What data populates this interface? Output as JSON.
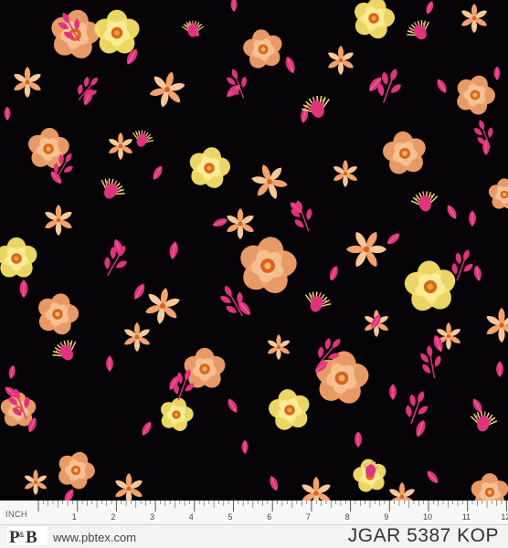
{
  "fabric": {
    "background_color": "#050305",
    "palette": {
      "peach": "#f3a26c",
      "peach_light": "#f8c79a",
      "orange_center": "#d8651f",
      "yellow": "#f6e16a",
      "yellow_light": "#fbef9c",
      "pink": "#e0337e",
      "pink_light": "#f07aa6"
    },
    "motifs": [
      "peach-rose-icon",
      "yellow-rose-icon",
      "pink-leaf-icon",
      "thistle-icon",
      "lily-icon"
    ]
  },
  "ruler": {
    "unit_label": "INCH",
    "numbers": [
      "1",
      "2",
      "3",
      "4",
      "5",
      "6",
      "7",
      "8",
      "9",
      "10",
      "11",
      "12"
    ]
  },
  "brand": {
    "logo_text": "P&B",
    "website": "www.pbtex.com"
  },
  "product": {
    "sku": "JGAR 5387 KOP"
  }
}
